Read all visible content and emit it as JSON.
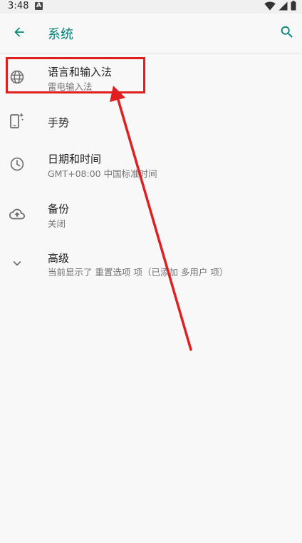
{
  "status_bar": {
    "time": "3:48",
    "notification_letter": "A"
  },
  "app_bar": {
    "title": "系统"
  },
  "menu": {
    "items": [
      {
        "title": "语言和输入法",
        "subtitle": "雷电输入法",
        "icon": "globe-icon"
      },
      {
        "title": "手势",
        "subtitle": "",
        "icon": "gesture-phone-icon"
      },
      {
        "title": "日期和时间",
        "subtitle": "GMT+08:00 中国标准时间",
        "icon": "clock-icon"
      },
      {
        "title": "备份",
        "subtitle": "关闭",
        "icon": "cloud-upload-icon"
      },
      {
        "title": "高级",
        "subtitle": "当前显示了 重置选项 项（已添加 多用户 项）",
        "icon": "chevron-down-icon"
      }
    ]
  },
  "colors": {
    "accent": "#008577",
    "annotation": "#e02020",
    "background": "#f8f8f8"
  }
}
